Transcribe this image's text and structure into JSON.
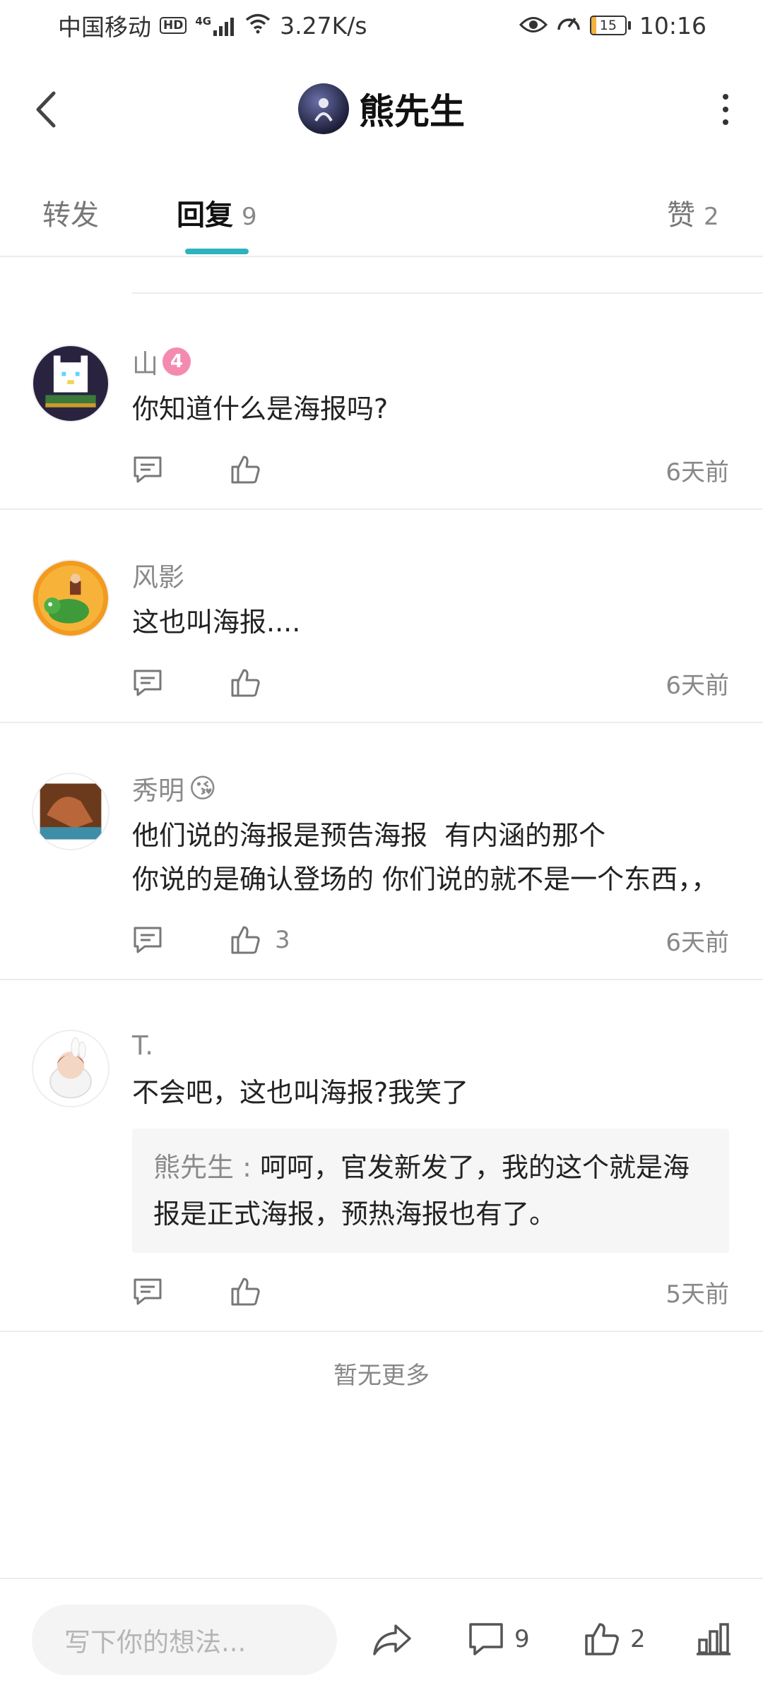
{
  "status_bar": {
    "carrier": "中国移动",
    "hd": "HD",
    "network": "4G",
    "speed": "3.27K/s",
    "battery": "15",
    "battery_level_percent": 15,
    "time": "10:16"
  },
  "header": {
    "title": "熊先生"
  },
  "tabs": {
    "forward_label": "转发",
    "reply_label": "回复",
    "reply_count": "9",
    "like_label": "赞",
    "like_count": "2",
    "active": "reply"
  },
  "comments": [
    {
      "name": "山",
      "badge": "4",
      "text": "你知道什么是海报吗?",
      "likes": "",
      "time": "6天前"
    },
    {
      "name": "风影",
      "text": "这也叫海报....",
      "likes": "",
      "time": "6天前"
    },
    {
      "name": "秀明",
      "emoji": "😘",
      "text": "他们说的海报是预告海报  有内涵的那个\n你说的是确认登场的 你们说的就不是一个东西，，",
      "likes": "3",
      "time": "6天前"
    },
    {
      "name": "T.",
      "text": "不会吧，这也叫海报?我笑了",
      "quote_name": "熊先生 : ",
      "quote_text": "呵呵，官发新发了，我的这个就是海报是正式海报，预热海报也有了。",
      "likes": "",
      "time": "5天前"
    }
  ],
  "no_more": "暂无更多",
  "bottom_bar": {
    "input_placeholder": "写下你的想法...",
    "comment_count": "9",
    "like_count": "2"
  },
  "colors": {
    "accent": "#2bb3c0",
    "badge_pink": "#f58ab0"
  }
}
